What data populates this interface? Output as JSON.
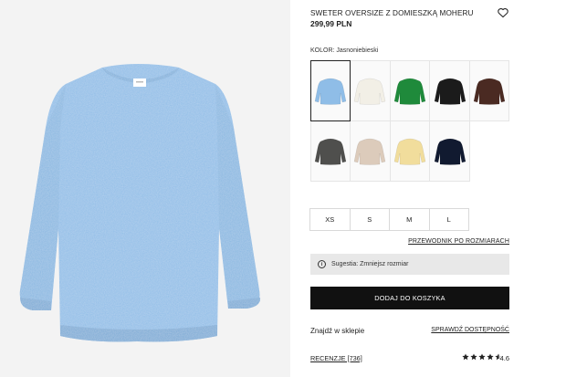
{
  "product": {
    "title": "SWETER OVERSIZE Z DOMIESZKĄ MOHERU",
    "price": "299,99 PLN",
    "color_label": "KOLOR: Jasnoniebieski",
    "favorite_icon": "heart-icon",
    "main_image_color": "#8fbde7"
  },
  "swatches": [
    {
      "name": "Jasnoniebieski",
      "color": "#8fbde7",
      "selected": true
    },
    {
      "name": "Kremowy",
      "color": "#f2efe6",
      "selected": false
    },
    {
      "name": "Zielony",
      "color": "#1f8a3b",
      "selected": false
    },
    {
      "name": "Czarny",
      "color": "#1b1b1b",
      "selected": false
    },
    {
      "name": "Brązowy",
      "color": "#4a2a22",
      "selected": false
    },
    {
      "name": "Szary",
      "color": "#4f4f4d",
      "selected": false
    },
    {
      "name": "Beżowy",
      "color": "#dccbbb",
      "selected": false
    },
    {
      "name": "Żółty",
      "color": "#f1dd9c",
      "selected": false
    },
    {
      "name": "Granatowy",
      "color": "#111a30",
      "selected": false
    }
  ],
  "sizes": [
    "XS",
    "S",
    "M",
    "L"
  ],
  "size_guide": "PRZEWODNIK PO ROZMIARACH",
  "hint": {
    "text": "Sugestia: Zmniejsz rozmiar",
    "icon": "info-icon"
  },
  "add_to_cart": "DODAJ DO KOSZYKA",
  "store": {
    "label": "Znajdź w sklepie",
    "link": "SPRAWDŹ DOSTĘPNOŚĆ"
  },
  "reviews": {
    "label": "RECENZJE [736]",
    "rating": "4.6",
    "stars": 4.6
  }
}
